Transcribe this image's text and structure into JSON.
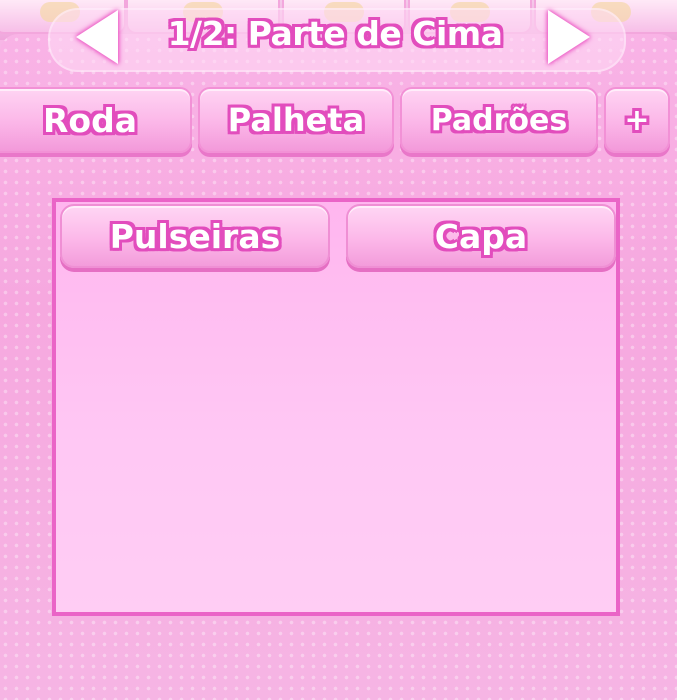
{
  "header": {
    "title": "1/2: Parte de Cima",
    "prev_icon": "arrow-left-icon",
    "next_icon": "arrow-right-icon"
  },
  "tabs": [
    {
      "label": "Roda"
    },
    {
      "label": "Palheta"
    },
    {
      "label": "Padrões"
    },
    {
      "label": "+"
    }
  ],
  "categories": [
    {
      "label": "Pulseiras"
    },
    {
      "label": "Capa"
    }
  ],
  "colors": {
    "panel": "#f7b0e4",
    "outline": "#e24dbd",
    "content_border": "#ea64c7",
    "text": "#ffffff"
  }
}
